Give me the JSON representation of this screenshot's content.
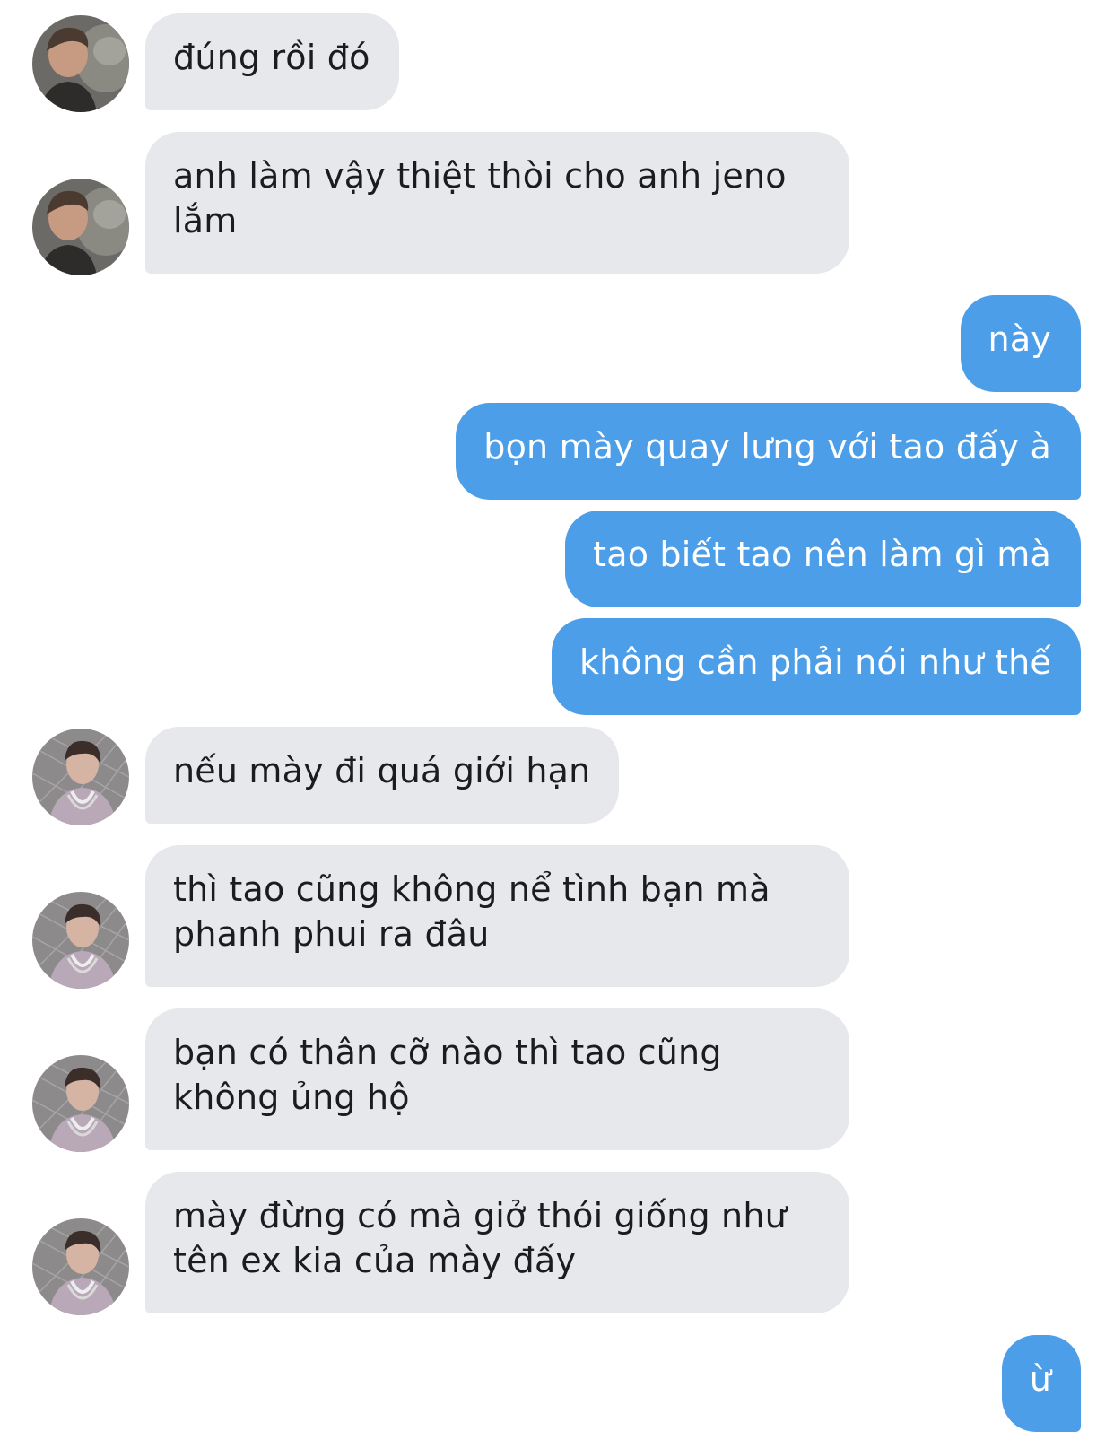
{
  "conversation": {
    "messages": [
      {
        "side": "in",
        "avatar": "boy-grey-hoodie-avatar",
        "text": "đúng rồi đó"
      },
      {
        "side": "in",
        "avatar": "boy-grey-hoodie-avatar",
        "text": "anh làm vậy thiệt thòi cho anh jeno\nlắm"
      },
      {
        "side": "out",
        "text": "này"
      },
      {
        "side": "out",
        "text": "bọn mày quay lưng với tao đấy à"
      },
      {
        "side": "out",
        "text": "tao biết tao nên làm gì mà"
      },
      {
        "side": "out",
        "text": "không cần phải nói như thế"
      },
      {
        "side": "in",
        "avatar": "boy-chain-fence-avatar",
        "text": "nếu mày đi quá giới hạn"
      },
      {
        "side": "in",
        "avatar": "boy-chain-fence-avatar",
        "text": "thì tao cũng không nể tình bạn mà\nphanh phui ra đâu"
      },
      {
        "side": "in",
        "avatar": "boy-chain-fence-avatar",
        "text": "bạn có thân cỡ nào thì tao cũng\nkhông ủng hộ"
      },
      {
        "side": "in",
        "avatar": "boy-chain-fence-avatar",
        "text": "mày đừng có mà giở thói giống như\ntên ex kia của mày đấy"
      },
      {
        "side": "out",
        "text": "ừ"
      }
    ]
  },
  "colors": {
    "incoming_bubble": "#e7e8ec",
    "outgoing_bubble": "#4c9ee8",
    "incoming_text": "#1c1c1e",
    "outgoing_text": "#ffffff"
  }
}
